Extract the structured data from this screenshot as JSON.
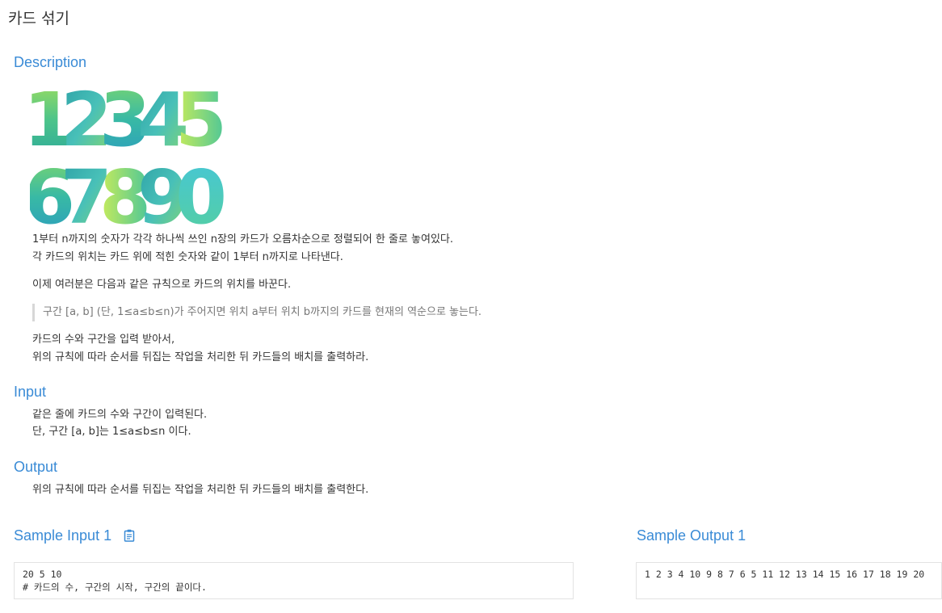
{
  "page": {
    "title": "카드 섞기"
  },
  "description": {
    "heading": "Description",
    "image_digits_row1": [
      "1",
      "2",
      "3",
      "4",
      "5"
    ],
    "image_digits_row2": [
      "6",
      "7",
      "8",
      "9",
      "0"
    ],
    "paragraph1_line1": "1부터 n까지의 숫자가 각각 하나씩 쓰인 n장의 카드가 오름차순으로 정렬되어 한 줄로 놓여있다.",
    "paragraph1_line2": "각 카드의 위치는 카드 위에 적힌 숫자와 같이 1부터 n까지로 나타낸다.",
    "paragraph2": "이제 여러분은 다음과 같은 규칙으로 카드의 위치를 바꾼다.",
    "quote": "구간 [a, b] (단, 1≤a≤b≤n)가 주어지면 위치 a부터 위치 b까지의 카드를 현재의 역순으로 놓는다.",
    "paragraph3_line1": "카드의 수와 구간을 입력 받아서,",
    "paragraph3_line2": "위의 규칙에 따라 순서를 뒤집는 작업을 처리한 뒤 카드들의 배치를 출력하라."
  },
  "input": {
    "heading": "Input",
    "line1": "같은 줄에 카드의 수와 구간이 입력된다.",
    "line2": "단, 구간 [a, b]는 1≤a≤b≤n 이다."
  },
  "output": {
    "heading": "Output",
    "line1": "위의 규칙에 따라 순서를 뒤집는 작업을 처리한 뒤 카드들의 배치를 출력한다."
  },
  "sample_input": {
    "heading": "Sample Input 1",
    "copy_icon": "clipboard-icon",
    "line1": "20 5 10",
    "line2": "# 카드의 수, 구간의 시작, 구간의 끝이다."
  },
  "sample_output": {
    "heading": "Sample Output 1",
    "line1": "1 2 3 4 10 9 8 7 6 5 11 12 13 14 15 16 17 18 19 20"
  },
  "colors": {
    "heading": "#3a8bd6",
    "text": "#333333",
    "quote_text": "#777777",
    "quote_border": "#d7d7d7",
    "box_border": "#e3e3e3"
  }
}
